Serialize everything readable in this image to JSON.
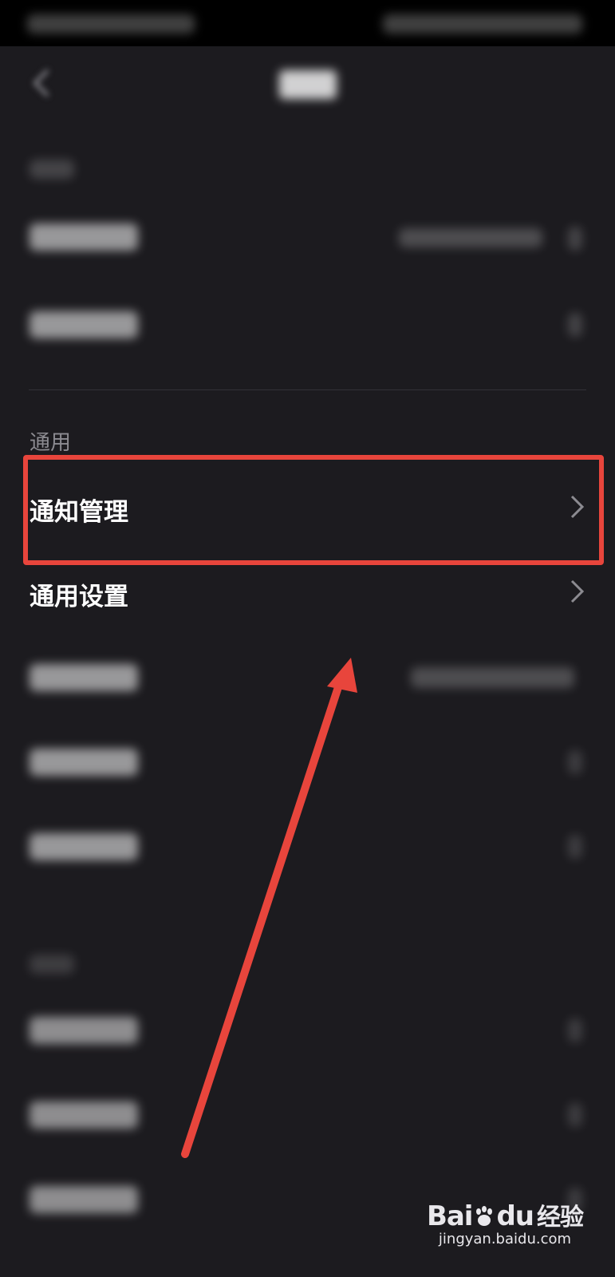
{
  "general_section": {
    "label": "通用",
    "items": [
      {
        "label": "通知管理",
        "highlighted": true
      },
      {
        "label": "通用设置",
        "highlighted": false
      }
    ]
  },
  "watermark": {
    "brand_text": "Bai",
    "brand_text_2": "du",
    "brand_cn": "经验",
    "domain": "jingyan.baidu.com"
  },
  "colors": {
    "background": "#1c1b1f",
    "annotation_red": "#e8453c",
    "text_primary": "#ffffff",
    "text_secondary": "#8c8b91"
  },
  "icons": [
    "back-arrow-icon",
    "chevron-right-icon",
    "baidu-paw-icon"
  ]
}
